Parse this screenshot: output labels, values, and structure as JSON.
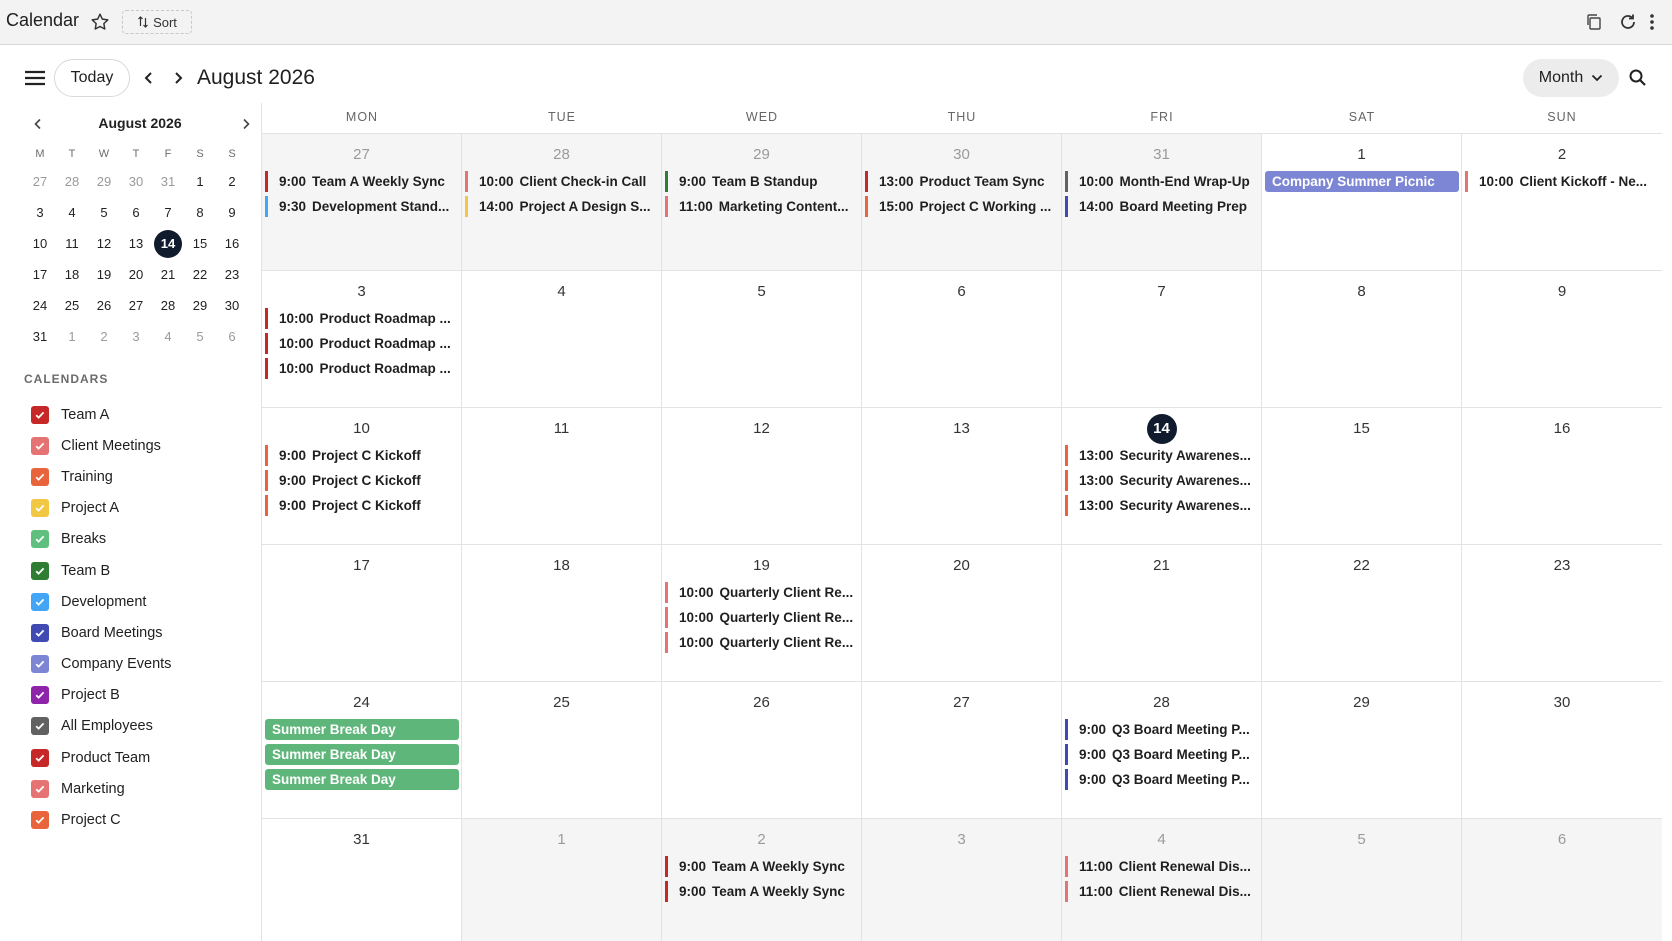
{
  "app": {
    "title": "Calendar",
    "sort_label": "Sort"
  },
  "toolbar": {
    "today_label": "Today",
    "month_title": "August 2026",
    "view_label": "Month"
  },
  "mini": {
    "title": "August 2026",
    "dow": [
      "M",
      "T",
      "W",
      "T",
      "F",
      "S",
      "S"
    ],
    "days": [
      {
        "n": "27",
        "other": true
      },
      {
        "n": "28",
        "other": true
      },
      {
        "n": "29",
        "other": true
      },
      {
        "n": "30",
        "other": true
      },
      {
        "n": "31",
        "other": true
      },
      {
        "n": "1"
      },
      {
        "n": "2"
      },
      {
        "n": "3"
      },
      {
        "n": "4"
      },
      {
        "n": "5"
      },
      {
        "n": "6"
      },
      {
        "n": "7"
      },
      {
        "n": "8"
      },
      {
        "n": "9"
      },
      {
        "n": "10"
      },
      {
        "n": "11"
      },
      {
        "n": "12"
      },
      {
        "n": "13"
      },
      {
        "n": "14",
        "today": true
      },
      {
        "n": "15"
      },
      {
        "n": "16"
      },
      {
        "n": "17"
      },
      {
        "n": "18"
      },
      {
        "n": "19"
      },
      {
        "n": "20"
      },
      {
        "n": "21"
      },
      {
        "n": "22"
      },
      {
        "n": "23"
      },
      {
        "n": "24"
      },
      {
        "n": "25"
      },
      {
        "n": "26"
      },
      {
        "n": "27"
      },
      {
        "n": "28"
      },
      {
        "n": "29"
      },
      {
        "n": "30"
      },
      {
        "n": "31"
      },
      {
        "n": "1",
        "other": true
      },
      {
        "n": "2",
        "other": true
      },
      {
        "n": "3",
        "other": true
      },
      {
        "n": "4",
        "other": true
      },
      {
        "n": "5",
        "other": true
      },
      {
        "n": "6",
        "other": true
      }
    ]
  },
  "calendars_heading": "CALENDARS",
  "calendars": [
    {
      "name": "Team A",
      "color": "#c62828"
    },
    {
      "name": "Client Meetings",
      "color": "#e57373"
    },
    {
      "name": "Training",
      "color": "#e8643a"
    },
    {
      "name": "Project A",
      "color": "#f2c744"
    },
    {
      "name": "Breaks",
      "color": "#5fbf7f"
    },
    {
      "name": "Team B",
      "color": "#2e7d32"
    },
    {
      "name": "Development",
      "color": "#42a5f5"
    },
    {
      "name": "Board Meetings",
      "color": "#3f4bb3"
    },
    {
      "name": "Company Events",
      "color": "#7c86d4"
    },
    {
      "name": "Project B",
      "color": "#8e24aa"
    },
    {
      "name": "All Employees",
      "color": "#616161"
    },
    {
      "name": "Product Team",
      "color": "#c62828"
    },
    {
      "name": "Marketing",
      "color": "#e57373"
    },
    {
      "name": "Project C",
      "color": "#e8643a"
    }
  ],
  "dow_headers": [
    "MON",
    "TUE",
    "WED",
    "THU",
    "FRI",
    "SAT",
    "SUN"
  ],
  "weeks": [
    [
      {
        "num": "27",
        "other": true,
        "past": true,
        "events": [
          {
            "time": "9:00",
            "title": "Team A Weekly Sync",
            "color": "#c62828"
          },
          {
            "time": "9:30",
            "title": "Development Stand...",
            "color": "#42a5f5"
          }
        ]
      },
      {
        "num": "28",
        "other": true,
        "past": true,
        "events": [
          {
            "time": "10:00",
            "title": "Client Check-in Call",
            "color": "#e57373"
          },
          {
            "time": "14:00",
            "title": "Project A Design S...",
            "color": "#f2c744"
          }
        ]
      },
      {
        "num": "29",
        "other": true,
        "past": true,
        "events": [
          {
            "time": "9:00",
            "title": "Team B Standup",
            "color": "#2e7d32"
          },
          {
            "time": "11:00",
            "title": "Marketing Content...",
            "color": "#e57373"
          }
        ]
      },
      {
        "num": "30",
        "other": true,
        "past": true,
        "events": [
          {
            "time": "13:00",
            "title": "Product Team Sync",
            "color": "#c62828"
          },
          {
            "time": "15:00",
            "title": "Project C Working ...",
            "color": "#e8643a"
          }
        ]
      },
      {
        "num": "31",
        "other": true,
        "past": true,
        "events": [
          {
            "time": "10:00",
            "title": "Month-End Wrap-Up",
            "color": "#616161"
          },
          {
            "time": "14:00",
            "title": "Board Meeting Prep",
            "color": "#3f4bb3"
          }
        ]
      },
      {
        "num": "1",
        "events": [
          {
            "allday": true,
            "title": "Company Summer Picnic",
            "color": "#7c86d4"
          }
        ]
      },
      {
        "num": "2",
        "events": [
          {
            "time": "10:00",
            "title": "Client Kickoff - Ne...",
            "color": "#e57373"
          }
        ]
      }
    ],
    [
      {
        "num": "3",
        "events": [
          {
            "time": "10:00",
            "title": "Product Roadmap ...",
            "color": "#c62828"
          },
          {
            "time": "10:00",
            "title": "Product Roadmap ...",
            "color": "#c62828"
          },
          {
            "time": "10:00",
            "title": "Product Roadmap ...",
            "color": "#c62828"
          }
        ]
      },
      {
        "num": "4",
        "events": []
      },
      {
        "num": "5",
        "events": []
      },
      {
        "num": "6",
        "events": []
      },
      {
        "num": "7",
        "events": []
      },
      {
        "num": "8",
        "events": []
      },
      {
        "num": "9",
        "events": []
      }
    ],
    [
      {
        "num": "10",
        "events": [
          {
            "time": "9:00",
            "title": "Project C Kickoff",
            "color": "#e8643a"
          },
          {
            "time": "9:00",
            "title": "Project C Kickoff",
            "color": "#e8643a"
          },
          {
            "time": "9:00",
            "title": "Project C Kickoff",
            "color": "#e8643a"
          }
        ]
      },
      {
        "num": "11",
        "events": []
      },
      {
        "num": "12",
        "events": []
      },
      {
        "num": "13",
        "events": []
      },
      {
        "num": "14",
        "today": true,
        "events": [
          {
            "time": "13:00",
            "title": "Security Awarenes...",
            "color": "#e8643a"
          },
          {
            "time": "13:00",
            "title": "Security Awarenes...",
            "color": "#e8643a"
          },
          {
            "time": "13:00",
            "title": "Security Awarenes...",
            "color": "#e8643a"
          }
        ]
      },
      {
        "num": "15",
        "events": []
      },
      {
        "num": "16",
        "events": []
      }
    ],
    [
      {
        "num": "17",
        "events": []
      },
      {
        "num": "18",
        "events": []
      },
      {
        "num": "19",
        "events": [
          {
            "time": "10:00",
            "title": "Quarterly Client Re...",
            "color": "#e57373"
          },
          {
            "time": "10:00",
            "title": "Quarterly Client Re...",
            "color": "#e57373"
          },
          {
            "time": "10:00",
            "title": "Quarterly Client Re...",
            "color": "#e57373"
          }
        ]
      },
      {
        "num": "20",
        "events": []
      },
      {
        "num": "21",
        "events": []
      },
      {
        "num": "22",
        "events": []
      },
      {
        "num": "23",
        "events": []
      }
    ],
    [
      {
        "num": "24",
        "events": [
          {
            "allday": true,
            "title": "Summer Break Day",
            "color": "#5fb67a"
          },
          {
            "allday": true,
            "title": "Summer Break Day",
            "color": "#5fb67a"
          },
          {
            "allday": true,
            "title": "Summer Break Day",
            "color": "#5fb67a"
          }
        ]
      },
      {
        "num": "25",
        "events": []
      },
      {
        "num": "26",
        "events": []
      },
      {
        "num": "27",
        "events": []
      },
      {
        "num": "28",
        "events": [
          {
            "time": "9:00",
            "title": "Q3 Board Meeting P...",
            "color": "#3f4bb3"
          },
          {
            "time": "9:00",
            "title": "Q3 Board Meeting P...",
            "color": "#3f4bb3"
          },
          {
            "time": "9:00",
            "title": "Q3 Board Meeting P...",
            "color": "#3f4bb3"
          }
        ]
      },
      {
        "num": "29",
        "events": []
      },
      {
        "num": "30",
        "events": []
      }
    ],
    [
      {
        "num": "31",
        "events": []
      },
      {
        "num": "1",
        "other": true,
        "past": true,
        "events": []
      },
      {
        "num": "2",
        "other": true,
        "past": true,
        "events": [
          {
            "time": "9:00",
            "title": "Team A Weekly Sync",
            "color": "#c62828"
          },
          {
            "time": "9:00",
            "title": "Team A Weekly Sync",
            "color": "#c62828"
          }
        ]
      },
      {
        "num": "3",
        "other": true,
        "past": true,
        "events": []
      },
      {
        "num": "4",
        "other": true,
        "past": true,
        "events": [
          {
            "time": "11:00",
            "title": "Client Renewal Dis...",
            "color": "#e57373"
          },
          {
            "time": "11:00",
            "title": "Client Renewal Dis...",
            "color": "#e57373"
          }
        ]
      },
      {
        "num": "5",
        "other": true,
        "past": true,
        "events": []
      },
      {
        "num": "6",
        "other": true,
        "past": true,
        "events": []
      }
    ]
  ]
}
